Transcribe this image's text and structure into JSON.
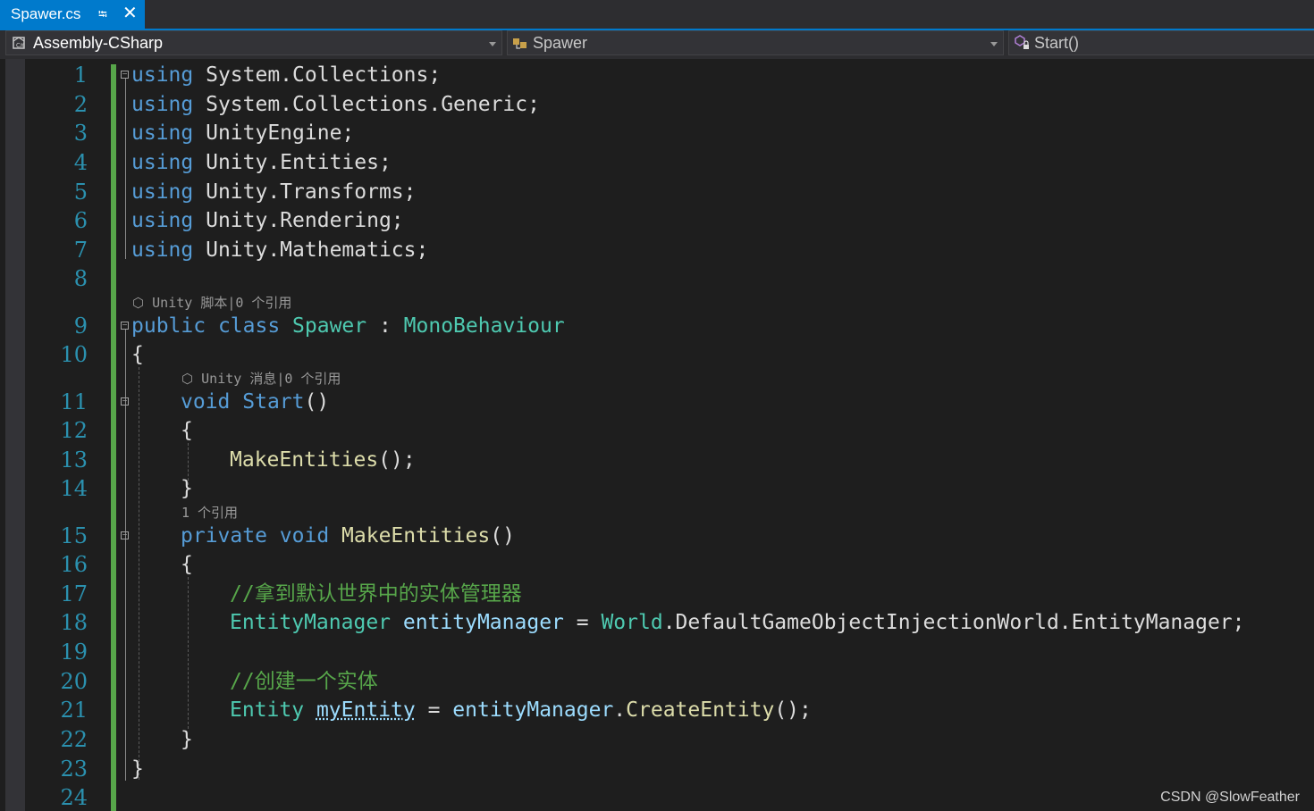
{
  "tab": {
    "title": "Spawer.cs"
  },
  "nav": {
    "project": "Assembly-CSharp",
    "class": "Spawer",
    "member": "Start()"
  },
  "editor": {
    "line_numbers": [
      "1",
      "2",
      "3",
      "4",
      "5",
      "6",
      "7",
      "8",
      "9",
      "10",
      "11",
      "12",
      "13",
      "14",
      "15",
      "16",
      "17",
      "18",
      "19",
      "20",
      "21",
      "22",
      "23",
      "24"
    ],
    "lines": {
      "l1": [
        "using",
        " System.Collections;"
      ],
      "l2": [
        "using",
        " System.Collections.Generic;"
      ],
      "l3": [
        "using",
        " UnityEngine;"
      ],
      "l4": [
        "using",
        " Unity.Entities;"
      ],
      "l5": [
        "using",
        " Unity.Transforms;"
      ],
      "l6": [
        "using",
        " Unity.Rendering;"
      ],
      "l7": [
        "using",
        " Unity.Mathematics;"
      ],
      "l9": [
        "public",
        " class ",
        "Spawer",
        " : ",
        "MonoBehaviour"
      ],
      "l10": [
        "{"
      ],
      "l11": [
        "void",
        " ",
        "Start",
        "()"
      ],
      "l12": [
        "{"
      ],
      "l13": [
        "MakeEntities",
        "();"
      ],
      "l14": [
        "}"
      ],
      "l15": [
        "private",
        " ",
        "void",
        " ",
        "MakeEntities",
        "()"
      ],
      "l16": [
        "{"
      ],
      "l17": [
        "//拿到默认世界中的实体管理器"
      ],
      "l18": [
        "EntityManager",
        " ",
        "entityManager",
        " = ",
        "World",
        ".DefaultGameObjectInjectionWorld.EntityManager;"
      ],
      "l20": [
        "//创建一个实体"
      ],
      "l21": [
        "Entity",
        " ",
        "myEntity",
        " = ",
        "entityManager",
        ".",
        "CreateEntity",
        "();"
      ],
      "l22": [
        "}"
      ],
      "l23": [
        "}"
      ]
    },
    "codelens": {
      "class_lens": "Unity 脚本|0 个引用",
      "start_lens": "Unity 消息|0 个引用",
      "make_lens": "1 个引用"
    }
  },
  "watermark": "CSDN @SlowFeather",
  "colors": {
    "background": "#1e1e1e",
    "keyword": "#569cd6",
    "type": "#4ec9b0",
    "method": "#dcdcaa",
    "comment": "#57a64a",
    "line_number": "#2b91af",
    "accent": "#007acc"
  }
}
